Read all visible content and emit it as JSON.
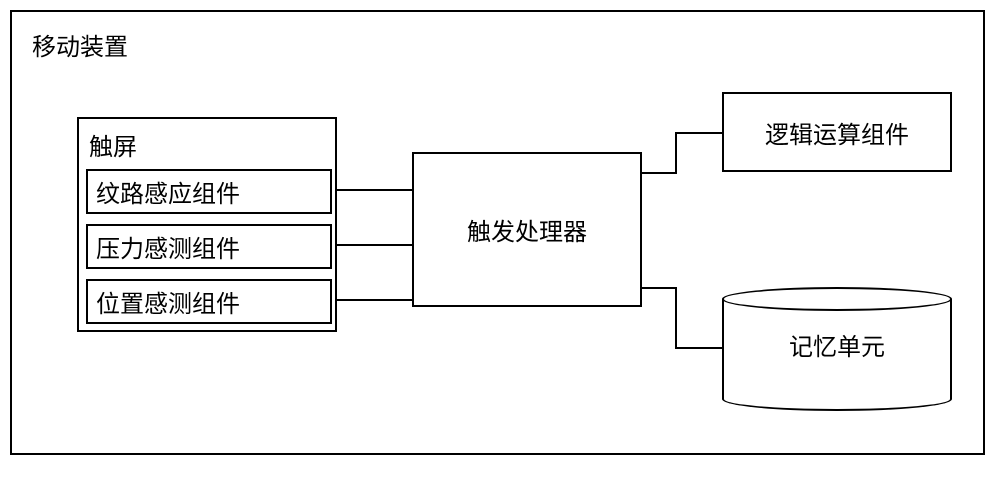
{
  "chart_data": {
    "type": "block-diagram",
    "container": {
      "id": "mobile-device",
      "label": "移动装置"
    },
    "nodes": [
      {
        "id": "touchscreen",
        "label": "触屏",
        "children": [
          {
            "id": "pattern-sensor",
            "label": "纹路感应组件"
          },
          {
            "id": "pressure-sensor",
            "label": "压力感测组件"
          },
          {
            "id": "position-sensor",
            "label": "位置感测组件"
          }
        ]
      },
      {
        "id": "trigger-processor",
        "label": "触发处理器"
      },
      {
        "id": "logic-unit",
        "label": "逻辑运算组件"
      },
      {
        "id": "memory-unit",
        "label": "记忆单元",
        "shape": "cylinder"
      }
    ],
    "edges": [
      {
        "from": "pattern-sensor",
        "to": "trigger-processor"
      },
      {
        "from": "pressure-sensor",
        "to": "trigger-processor"
      },
      {
        "from": "position-sensor",
        "to": "trigger-processor"
      },
      {
        "from": "trigger-processor",
        "to": "logic-unit"
      },
      {
        "from": "trigger-processor",
        "to": "memory-unit"
      }
    ]
  },
  "labels": {
    "container": "移动装置",
    "touchscreen": "触屏",
    "pattern": "纹路感应组件",
    "pressure": "压力感测组件",
    "position": "位置感测组件",
    "trigger": "触发处理器",
    "logic": "逻辑运算组件",
    "memory": "记忆单元"
  }
}
